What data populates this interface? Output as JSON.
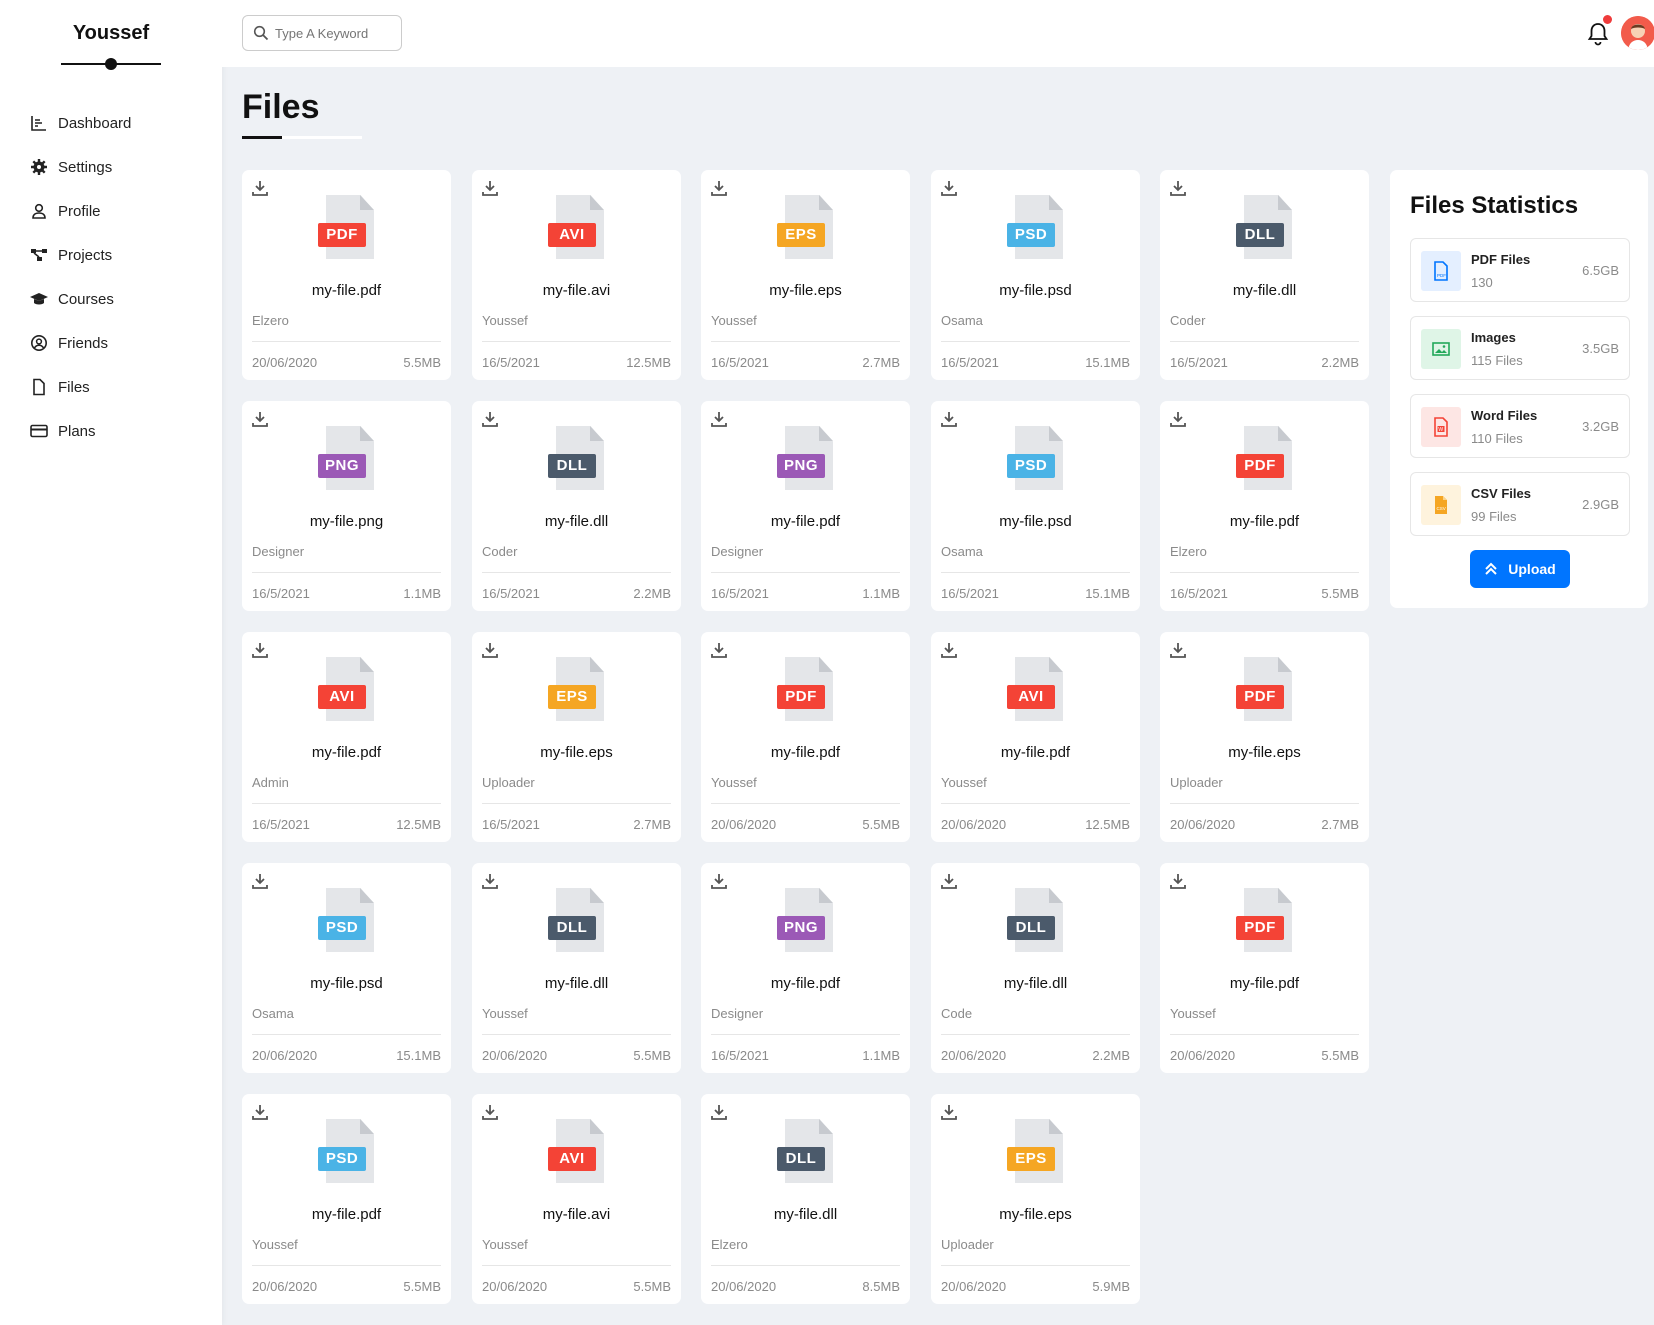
{
  "brand": "Youssef",
  "nav": [
    {
      "label": "Dashboard",
      "icon": "chart-icon"
    },
    {
      "label": "Settings",
      "icon": "gear-icon"
    },
    {
      "label": "Profile",
      "icon": "user-icon"
    },
    {
      "label": "Projects",
      "icon": "diagram-icon"
    },
    {
      "label": "Courses",
      "icon": "graduation-cap-icon"
    },
    {
      "label": "Friends",
      "icon": "user-circle-icon"
    },
    {
      "label": "Files",
      "icon": "file-icon"
    },
    {
      "label": "Plans",
      "icon": "credit-card-icon"
    }
  ],
  "search": {
    "placeholder": "Type A Keyword"
  },
  "page_title": "Files",
  "type_colors": {
    "PDF": "#f44336",
    "AVI": "#f44336",
    "EPS": "#f5a623",
    "PSD": "#4ab3e6",
    "DLL": "#4b5a6b",
    "PNG": "#9b59b6"
  },
  "files": [
    {
      "type": "PDF",
      "name": "my-file.pdf",
      "owner": "Elzero",
      "date": "20/06/2020",
      "size": "5.5MB"
    },
    {
      "type": "AVI",
      "name": "my-file.avi",
      "owner": "Youssef",
      "date": "16/5/2021",
      "size": "12.5MB"
    },
    {
      "type": "EPS",
      "name": "my-file.eps",
      "owner": "Youssef",
      "date": "16/5/2021",
      "size": "2.7MB"
    },
    {
      "type": "PSD",
      "name": "my-file.psd",
      "owner": "Osama",
      "date": "16/5/2021",
      "size": "15.1MB"
    },
    {
      "type": "DLL",
      "name": "my-file.dll",
      "owner": "Coder",
      "date": "16/5/2021",
      "size": "2.2MB"
    },
    {
      "type": "PNG",
      "name": "my-file.png",
      "owner": "Designer",
      "date": "16/5/2021",
      "size": "1.1MB"
    },
    {
      "type": "DLL",
      "name": "my-file.dll",
      "owner": "Coder",
      "date": "16/5/2021",
      "size": "2.2MB"
    },
    {
      "type": "PNG",
      "name": "my-file.pdf",
      "owner": "Designer",
      "date": "16/5/2021",
      "size": "1.1MB"
    },
    {
      "type": "PSD",
      "name": "my-file.psd",
      "owner": "Osama",
      "date": "16/5/2021",
      "size": "15.1MB"
    },
    {
      "type": "PDF",
      "name": "my-file.pdf",
      "owner": "Elzero",
      "date": "16/5/2021",
      "size": "5.5MB"
    },
    {
      "type": "AVI",
      "name": "my-file.pdf",
      "owner": "Admin",
      "date": "16/5/2021",
      "size": "12.5MB"
    },
    {
      "type": "EPS",
      "name": "my-file.eps",
      "owner": "Uploader",
      "date": "16/5/2021",
      "size": "2.7MB"
    },
    {
      "type": "PDF",
      "name": "my-file.pdf",
      "owner": "Youssef",
      "date": "20/06/2020",
      "size": "5.5MB"
    },
    {
      "type": "AVI",
      "name": "my-file.pdf",
      "owner": "Youssef",
      "date": "20/06/2020",
      "size": "12.5MB"
    },
    {
      "type": "PDF",
      "name": "my-file.eps",
      "owner": "Uploader",
      "date": "20/06/2020",
      "size": "2.7MB"
    },
    {
      "type": "PSD",
      "name": "my-file.psd",
      "owner": "Osama",
      "date": "20/06/2020",
      "size": "15.1MB"
    },
    {
      "type": "DLL",
      "name": "my-file.dll",
      "owner": "Youssef",
      "date": "20/06/2020",
      "size": "5.5MB"
    },
    {
      "type": "PNG",
      "name": "my-file.pdf",
      "owner": "Designer",
      "date": "16/5/2021",
      "size": "1.1MB"
    },
    {
      "type": "DLL",
      "name": "my-file.dll",
      "owner": "Code",
      "date": "20/06/2020",
      "size": "2.2MB"
    },
    {
      "type": "PDF",
      "name": "my-file.pdf",
      "owner": "Youssef",
      "date": "20/06/2020",
      "size": "5.5MB"
    },
    {
      "type": "PSD",
      "name": "my-file.pdf",
      "owner": "Youssef",
      "date": "20/06/2020",
      "size": "5.5MB"
    },
    {
      "type": "AVI",
      "name": "my-file.avi",
      "owner": "Youssef",
      "date": "20/06/2020",
      "size": "5.5MB"
    },
    {
      "type": "DLL",
      "name": "my-file.dll",
      "owner": "Elzero",
      "date": "20/06/2020",
      "size": "8.5MB"
    },
    {
      "type": "EPS",
      "name": "my-file.eps",
      "owner": "Uploader",
      "date": "20/06/2020",
      "size": "5.9MB"
    }
  ],
  "stats": {
    "title": "Files Statistics",
    "items": [
      {
        "label": "PDF Files",
        "count": "130",
        "size": "6.5GB",
        "icon": "pdf-file-icon",
        "color": "#0075ff",
        "bg": "#e4efff"
      },
      {
        "label": "Images",
        "count": "115 Files",
        "size": "3.5GB",
        "icon": "image-icon",
        "color": "#22a85a",
        "bg": "#dff5e7"
      },
      {
        "label": "Word Files",
        "count": "110 Files",
        "size": "3.2GB",
        "icon": "word-file-icon",
        "color": "#f44336",
        "bg": "#fde6e4"
      },
      {
        "label": "CSV Files",
        "count": "99 Files",
        "size": "2.9GB",
        "icon": "csv-file-icon",
        "color": "#f5a623",
        "bg": "#fef3dd"
      }
    ],
    "upload_label": "Upload"
  }
}
